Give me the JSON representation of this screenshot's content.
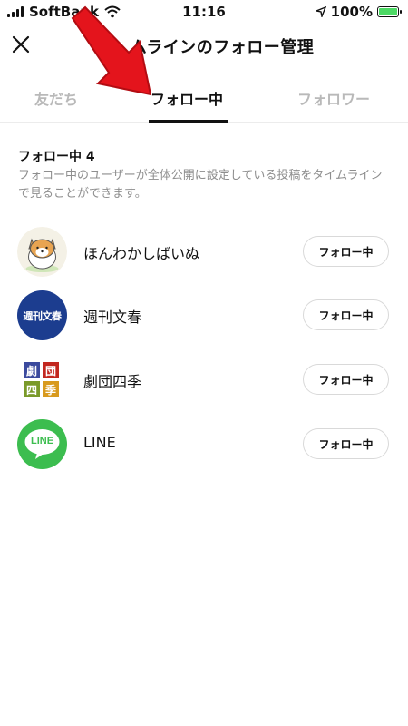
{
  "status_bar": {
    "carrier": "SoftBank",
    "time": "11:16",
    "battery": "100%"
  },
  "header": {
    "title": "ムラインのフォロー管理"
  },
  "tabs": [
    {
      "label": "友だち",
      "active": false
    },
    {
      "label": "フォロー中",
      "active": true
    },
    {
      "label": "フォロワー",
      "active": false
    }
  ],
  "section": {
    "title": "フォロー中 4",
    "description": "フォロー中のユーザーが全体公開に設定している投稿をタイムラインで見ることができます。"
  },
  "accounts": [
    {
      "name": "ほんわかしばいぬ",
      "button": "フォロー中",
      "avatar": "shiba-dog-icon"
    },
    {
      "name": "週刊文春",
      "button": "フォロー中",
      "avatar": "bunshun-logo",
      "logo_text": "週刊文春",
      "logo_color": "#1c3d8f"
    },
    {
      "name": "劇団四季",
      "button": "フォロー中",
      "avatar": "shiki-logo",
      "logo_chars": [
        "劇",
        "団",
        "四",
        "季"
      ]
    },
    {
      "name": "LINE",
      "button": "フォロー中",
      "avatar": "line-logo",
      "logo_text": "LINE",
      "logo_color": "#3cbd4f"
    }
  ],
  "colors": {
    "accent_arrow": "#e4141c",
    "line_green": "#3cbd4f",
    "tab_inactive": "#b9b9b9"
  }
}
